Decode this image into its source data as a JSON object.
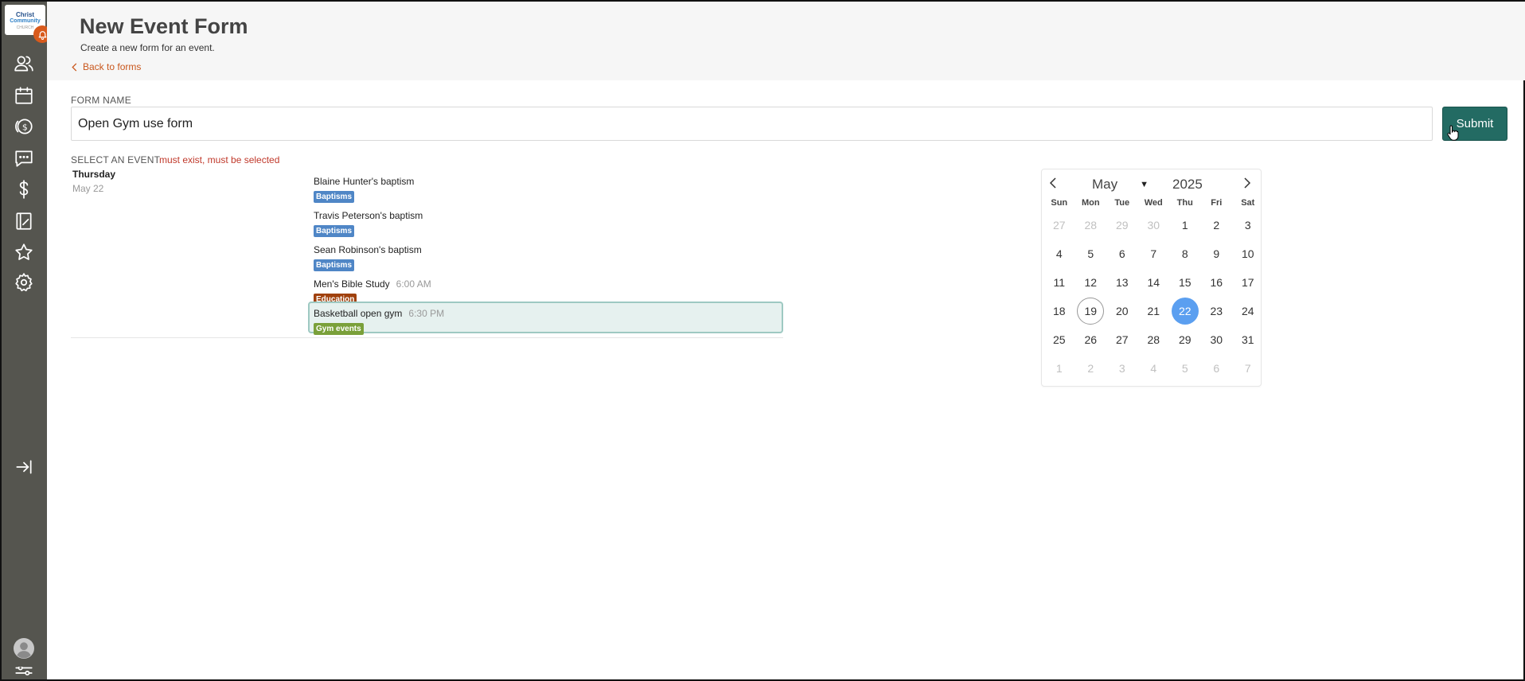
{
  "sidebar": {
    "logo": {
      "line1": "Christ",
      "line2": "Community",
      "line3": "CHURCH"
    },
    "icons": [
      "bell-icon",
      "people-icon",
      "calendar-icon",
      "giving-icon",
      "messages-icon",
      "dollar-icon",
      "notebook-icon",
      "star-icon",
      "gear-icon",
      "collapse-icon",
      "avatar-icon",
      "sliders-icon"
    ]
  },
  "header": {
    "title": "New Event Form",
    "subtitle": "Create a new form for an event.",
    "back_label": "Back to forms"
  },
  "form": {
    "name_label": "FORM NAME",
    "name_value": "Open Gym use form",
    "submit_label": "Submit",
    "select_label": "SELECT AN EVENT",
    "select_error": "must exist, must be selected"
  },
  "events_day": {
    "day_name": "Thursday",
    "day_date": "May 22",
    "events": [
      {
        "title": "Blaine Hunter's baptism",
        "time": "",
        "tag": "Baptisms",
        "tag_color": "#4f86c6",
        "selected": false
      },
      {
        "title": "Travis Peterson's baptism",
        "time": "",
        "tag": "Baptisms",
        "tag_color": "#4f86c6",
        "selected": false
      },
      {
        "title": "Sean Robinson's baptism",
        "time": "",
        "tag": "Baptisms",
        "tag_color": "#4f86c6",
        "selected": false
      },
      {
        "title": "Men's Bible Study",
        "time": "6:00 AM",
        "tag": "Education",
        "tag_color": "#a0410d",
        "selected": false
      },
      {
        "title": "Basketball open gym",
        "time": "6:30 PM",
        "tag": "Gym events",
        "tag_color": "#7aa03a",
        "selected": true
      }
    ]
  },
  "calendar": {
    "month": "May",
    "year": "2025",
    "weekdays": [
      "Sun",
      "Mon",
      "Tue",
      "Wed",
      "Thu",
      "Fri",
      "Sat"
    ],
    "days": [
      {
        "d": "27",
        "m": true
      },
      {
        "d": "28",
        "m": true
      },
      {
        "d": "29",
        "m": true
      },
      {
        "d": "30",
        "m": true
      },
      {
        "d": "1"
      },
      {
        "d": "2"
      },
      {
        "d": "3"
      },
      {
        "d": "4"
      },
      {
        "d": "5"
      },
      {
        "d": "6"
      },
      {
        "d": "7"
      },
      {
        "d": "8"
      },
      {
        "d": "9"
      },
      {
        "d": "10"
      },
      {
        "d": "11"
      },
      {
        "d": "12"
      },
      {
        "d": "13"
      },
      {
        "d": "14"
      },
      {
        "d": "15"
      },
      {
        "d": "16"
      },
      {
        "d": "17"
      },
      {
        "d": "18"
      },
      {
        "d": "19",
        "today": true
      },
      {
        "d": "20"
      },
      {
        "d": "21"
      },
      {
        "d": "22",
        "sel": true
      },
      {
        "d": "23"
      },
      {
        "d": "24"
      },
      {
        "d": "25"
      },
      {
        "d": "26"
      },
      {
        "d": "27"
      },
      {
        "d": "28"
      },
      {
        "d": "29"
      },
      {
        "d": "30"
      },
      {
        "d": "31"
      },
      {
        "d": "1",
        "m": true
      },
      {
        "d": "2",
        "m": true
      },
      {
        "d": "3",
        "m": true
      },
      {
        "d": "4",
        "m": true
      },
      {
        "d": "5",
        "m": true
      },
      {
        "d": "6",
        "m": true
      },
      {
        "d": "7",
        "m": true
      }
    ]
  },
  "colors": {
    "sidebar": "#55554f",
    "accent": "#c9571d",
    "submit": "#236b63",
    "selected_day": "#5b9ff0",
    "error": "#c0392b"
  }
}
